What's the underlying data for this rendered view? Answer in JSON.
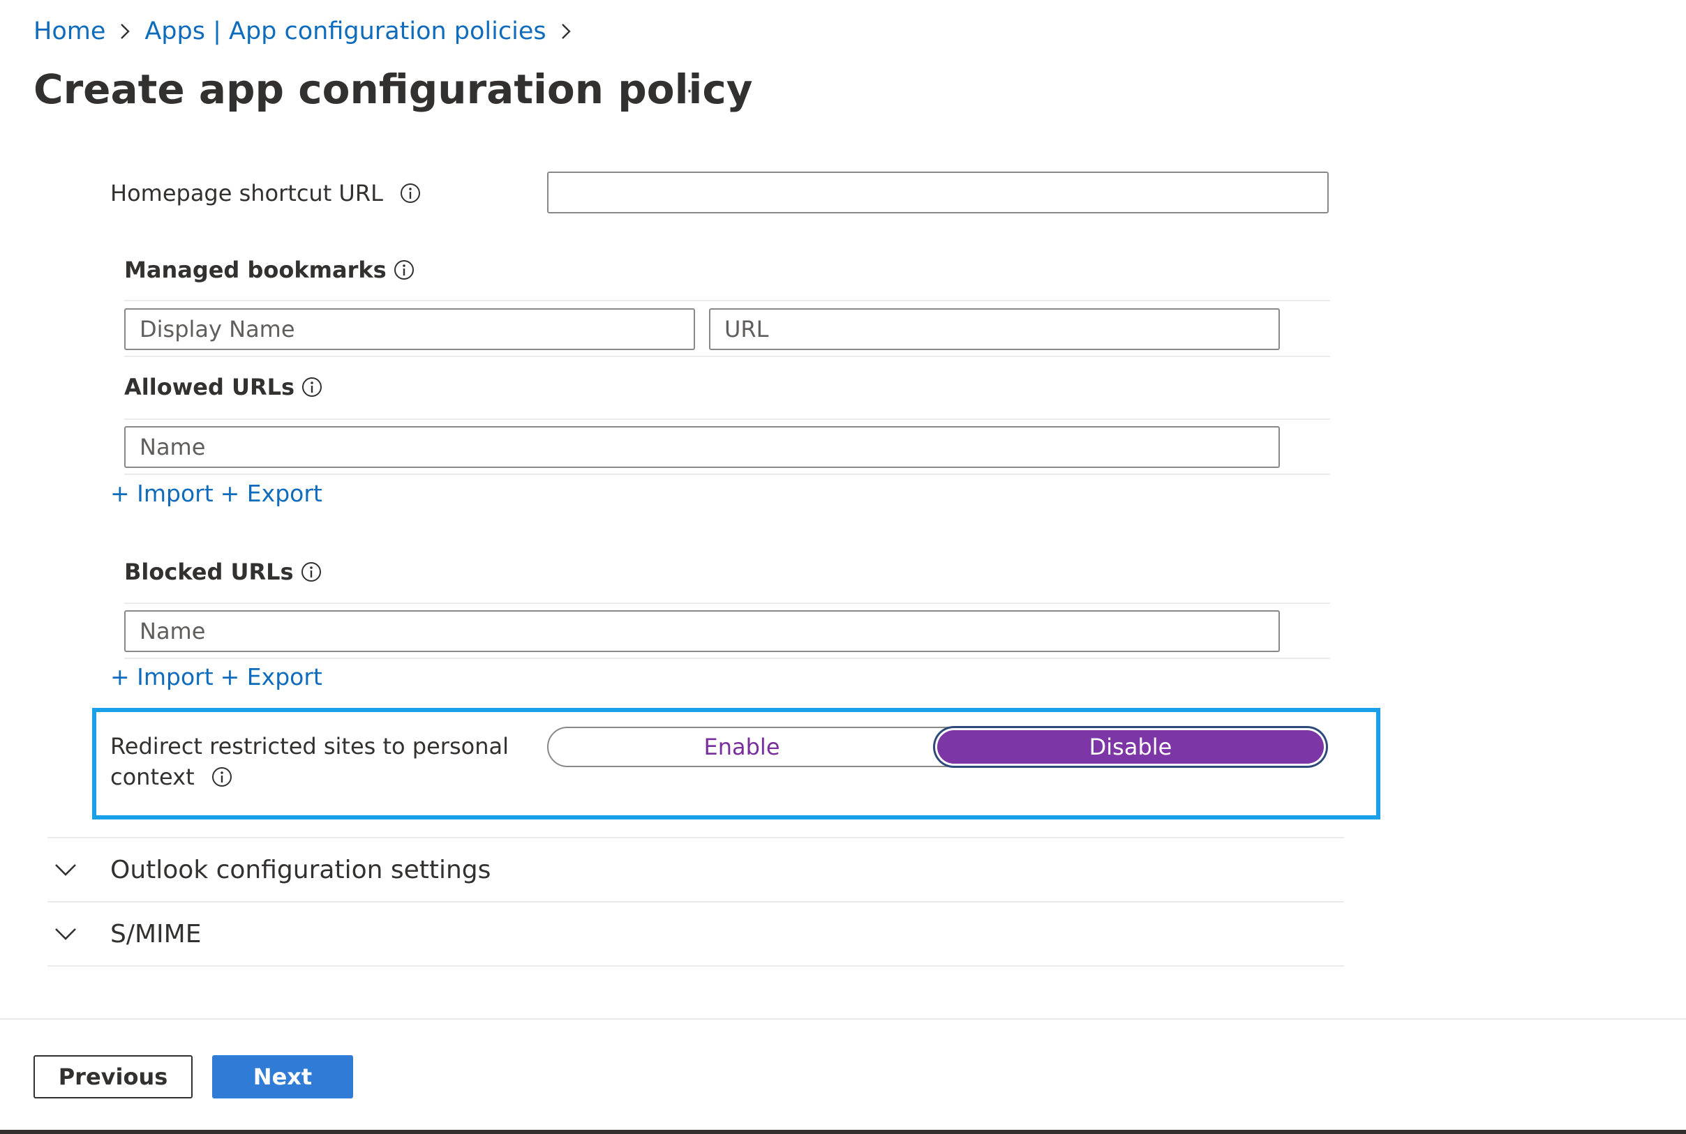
{
  "breadcrumb": {
    "home": "Home",
    "parent": "Apps | App configuration policies"
  },
  "page": {
    "title": "Create app configuration policy",
    "more": "···"
  },
  "homepage_shortcut": {
    "label": "Homepage shortcut URL",
    "value": ""
  },
  "managed_bookmarks": {
    "label": "Managed bookmarks",
    "display_name_placeholder": "Display Name",
    "url_placeholder": "URL"
  },
  "allowed_urls": {
    "label": "Allowed URLs",
    "name_placeholder": "Name",
    "import_label": "+ Import",
    "export_label": "+ Export"
  },
  "blocked_urls": {
    "label": "Blocked URLs",
    "name_placeholder": "Name",
    "import_label": "+ Import",
    "export_label": "+ Export"
  },
  "redirect": {
    "label_line1": "Redirect restricted sites to personal",
    "label_line2": "context",
    "enable_label": "Enable",
    "disable_label": "Disable",
    "selected": "Disable"
  },
  "accordions": [
    {
      "label": "Outlook configuration settings"
    },
    {
      "label": "S/MIME"
    }
  ],
  "footer": {
    "previous_label": "Previous",
    "next_label": "Next"
  },
  "colors": {
    "link": "#0f6cbd",
    "toggle_selected": "#7d36a5",
    "highlight": "#1aa0e8",
    "primary_button": "#2f7bd6"
  }
}
